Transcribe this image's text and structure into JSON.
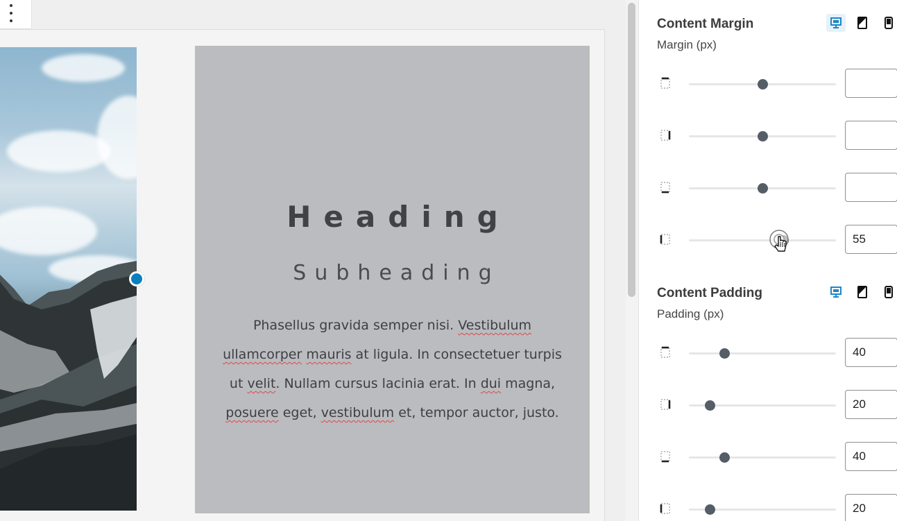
{
  "canvas": {
    "toolbar": {
      "icon": "more-vertical-icon"
    },
    "content": {
      "heading": "Heading",
      "subheading": "Subheading",
      "body": [
        {
          "text": "Phasellus gravida semper nisi. ",
          "spell": false
        },
        {
          "text": "Vestibulum",
          "spell": true
        },
        {
          "text": " ",
          "spell": false
        },
        {
          "text": "ullamcorper",
          "spell": true
        },
        {
          "text": " ",
          "spell": false
        },
        {
          "text": "mauris",
          "spell": true
        },
        {
          "text": " at ligula. In consectetuer turpis ut ",
          "spell": false
        },
        {
          "text": "velit",
          "spell": true
        },
        {
          "text": ". Nullam cursus lacinia erat. In ",
          "spell": false
        },
        {
          "text": "dui",
          "spell": true
        },
        {
          "text": " magna, ",
          "spell": false
        },
        {
          "text": "posuere",
          "spell": true
        },
        {
          "text": " eget, ",
          "spell": false
        },
        {
          "text": "vestibulum",
          "spell": true
        },
        {
          "text": " et, tempor auctor, justo.",
          "spell": false
        }
      ]
    }
  },
  "sidebar": {
    "margin": {
      "title": "Content Margin",
      "subtitle": "Margin (px)",
      "devices": [
        "desktop-icon",
        "tablet-icon",
        "mobile-icon"
      ],
      "active_device": "desktop",
      "rows": [
        {
          "side": "top",
          "icon": "margin-top-icon",
          "value": "",
          "slider": 0.5
        },
        {
          "side": "right",
          "icon": "margin-right-icon",
          "value": "",
          "slider": 0.5
        },
        {
          "side": "bottom",
          "icon": "margin-bottom-icon",
          "value": "",
          "slider": 0.5
        },
        {
          "side": "left",
          "icon": "margin-left-icon",
          "value": "55",
          "slider": 0.64
        }
      ]
    },
    "padding": {
      "title": "Content Padding",
      "subtitle": "Padding (px)",
      "devices": [
        "desktop-icon",
        "tablet-icon",
        "mobile-icon"
      ],
      "active_device": "desktop",
      "rows": [
        {
          "side": "top",
          "icon": "padding-top-icon",
          "value": "40",
          "slider": 0.24
        },
        {
          "side": "right",
          "icon": "padding-right-icon",
          "value": "20",
          "slider": 0.14
        },
        {
          "side": "bottom",
          "icon": "padding-bottom-icon",
          "value": "40",
          "slider": 0.24
        },
        {
          "side": "left",
          "icon": "padding-left-icon",
          "value": "20",
          "slider": 0.14
        }
      ]
    }
  },
  "colors": {
    "accent": "#0a7fbf",
    "content_bg": "#bbbcc0",
    "slider_thumb": "#555d66"
  }
}
